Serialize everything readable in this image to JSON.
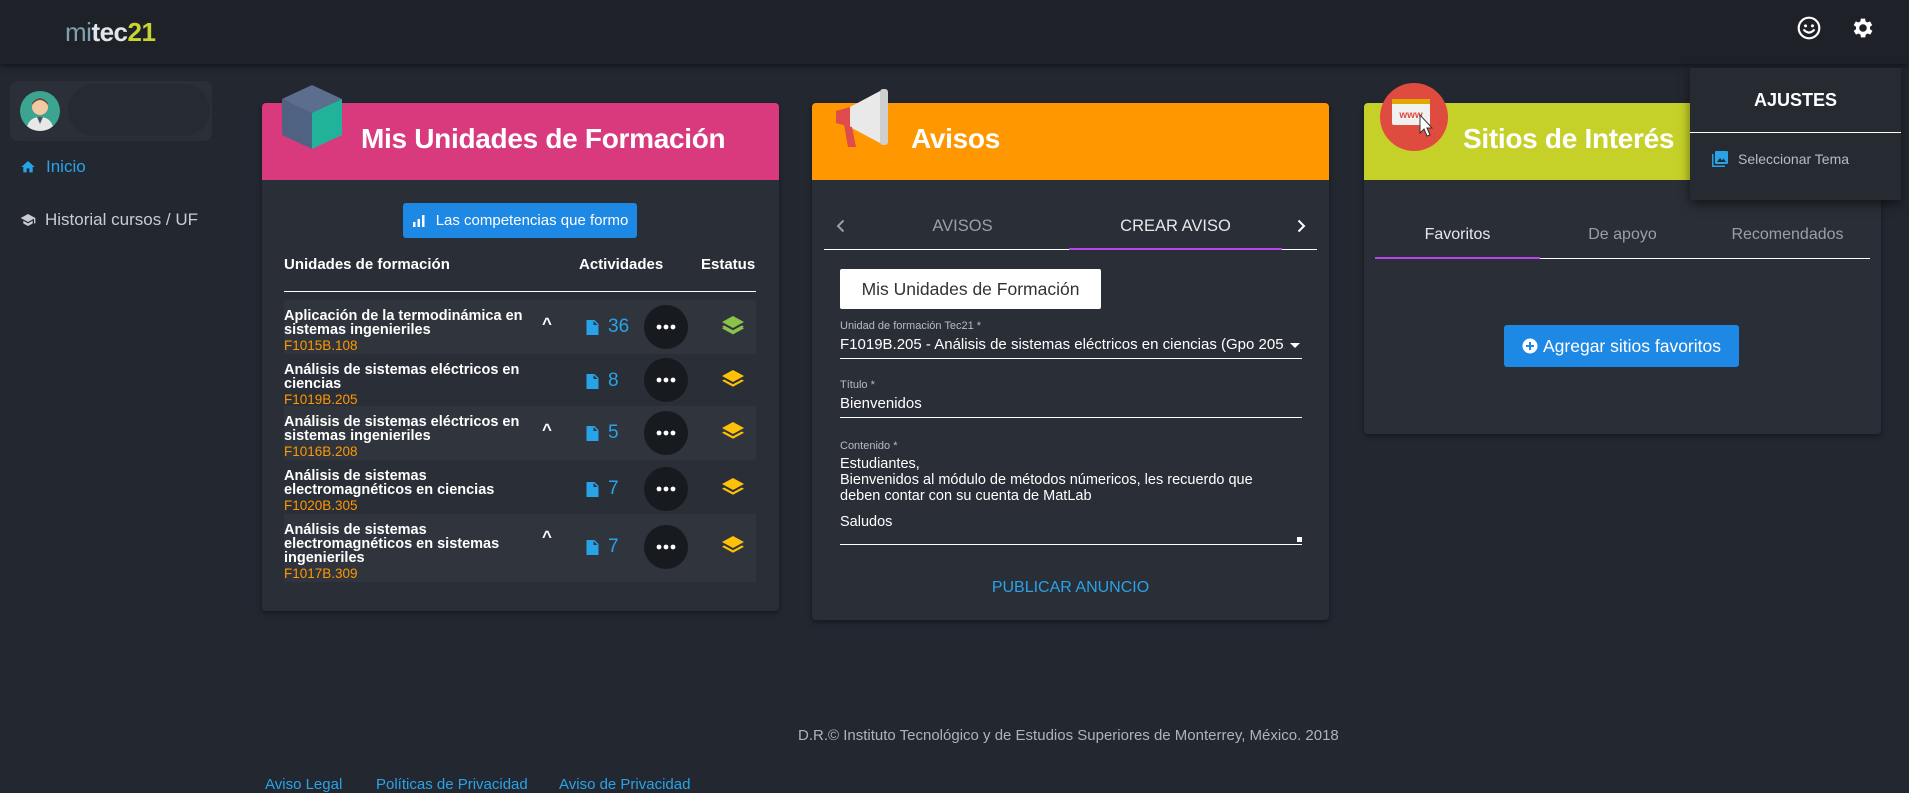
{
  "app": {
    "logo": {
      "mi": "mi",
      "tec": "tec",
      "n21": "21"
    },
    "icons": {
      "feedback": "smile-icon",
      "settings": "gear-icon"
    }
  },
  "sidebar": {
    "items": [
      {
        "label": "Inicio",
        "icon": "home-icon"
      },
      {
        "label": "Historial cursos / UF",
        "icon": "graduation-cap-icon"
      }
    ]
  },
  "uf_card": {
    "title": "Mis Unidades de Formación",
    "competencias_label": "Las competencias que formo",
    "columns": [
      "Unidades de formación",
      "Actividades",
      "Estatus"
    ],
    "rows": [
      {
        "name": "Aplicación de la termodinámica en sistemas ingenieriles",
        "code": "F1015B.108",
        "caret": "^",
        "activities": "36",
        "status_color": "#8bc34a"
      },
      {
        "name": "Análisis de sistemas eléctricos en ciencias",
        "code": "F1019B.205",
        "caret": "",
        "activities": "8",
        "status_color": "#ffc107"
      },
      {
        "name": "Análisis de sistemas eléctricos en sistemas ingenieriles",
        "code": "F1016B.208",
        "caret": "^",
        "activities": "5",
        "status_color": "#ffc107"
      },
      {
        "name": "Análisis de sistemas electromagnéticos en ciencias",
        "code": "F1020B.305",
        "caret": "",
        "activities": "7",
        "status_color": "#ffc107"
      },
      {
        "name": "Análisis de sistemas electromagnéticos en sistemas ingenieriles",
        "code": "F1017B.309",
        "caret": "^",
        "activities": "7",
        "status_color": "#ffc107"
      }
    ]
  },
  "avisos_card": {
    "title": "Avisos",
    "tabs": [
      "AVISOS",
      "CREAR AVISO"
    ],
    "active_tab": "CREAR AVISO",
    "chip_label": "Mis Unidades de Formación",
    "uf_select": {
      "label": "Unidad de formación Tec21 *",
      "value": "F1019B.205 - Análisis de sistemas eléctricos en ciencias (Gpo 205..."
    },
    "titulo": {
      "label": "Título *",
      "value": "Bienvenidos"
    },
    "contenido": {
      "label": "Contenido *",
      "lines": [
        "Estudiantes,",
        "Bienvenidos al módulo de métodos númericos, les recuerdo que",
        "deben contar con su cuenta de MatLab",
        "",
        "Saludos"
      ]
    },
    "publish_label": "PUBLICAR ANUNCIO"
  },
  "sitios_card": {
    "title": "Sitios de Interés",
    "tabs": [
      "Favoritos",
      "De apoyo",
      "Recomendados"
    ],
    "active_tab": "Favoritos",
    "add_label": "Agregar sitios favoritos"
  },
  "settings_panel": {
    "title": "AJUSTES",
    "items": [
      {
        "label": "Seleccionar Tema",
        "icon": "image-icon"
      }
    ]
  },
  "footer": {
    "copyright": "D.R.© Instituto Tecnológico y de Estudios Superiores de Monterrey, México. 2018",
    "links": [
      "Aviso Legal",
      "Políticas de Privacidad",
      "Aviso de Privacidad"
    ]
  }
}
